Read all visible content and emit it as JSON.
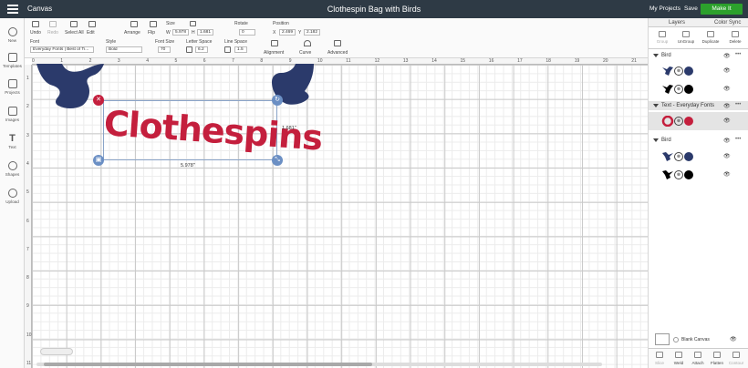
{
  "topbar": {
    "app_label": "Canvas",
    "title": "Clothespin Bag with Birds",
    "my_projects": "My Projects",
    "save": "Save",
    "make_it": "Make It"
  },
  "toolbar": {
    "undo": "Undo",
    "redo": "Redo",
    "select_all": "Select All",
    "edit": "Edit",
    "arrange": "Arrange",
    "flip": "Flip",
    "size_label": "Size",
    "w_label": "W",
    "w_value": "5.978",
    "h_label": "H",
    "h_value": "1.681",
    "rotate_label": "Rotate",
    "rotate_value": "0",
    "position_label": "Position",
    "x_label": "X",
    "x_value": "2.469",
    "y_label": "Y",
    "y_value": "2.182",
    "font_label": "Font",
    "font_value": "Everyday Fonts | Best of Ti...",
    "style_label": "Style",
    "style_value": "Bold",
    "font_size_label": "Font Size",
    "font_size_value": "70",
    "letter_space_label": "Letter Space",
    "letter_space_value": "6.2",
    "line_space_label": "Line Space",
    "line_space_value": "1.5",
    "alignment": "Alignment",
    "curve": "Curve",
    "advanced": "Advanced"
  },
  "leftbar": {
    "items": [
      "New",
      "Templates",
      "Projects",
      "Images",
      "Text",
      "Shapes",
      "Upload"
    ]
  },
  "ruler": {
    "top": [
      "0",
      "1",
      "2",
      "3",
      "4",
      "5",
      "6",
      "7",
      "8",
      "9",
      "10",
      "11",
      "12",
      "13",
      "14",
      "15",
      "16",
      "17",
      "18",
      "19",
      "20",
      "21"
    ],
    "left": [
      "1",
      "2",
      "3",
      "4",
      "5",
      "6",
      "7",
      "8",
      "9",
      "10",
      "11"
    ]
  },
  "canvas": {
    "text": "Clothespins",
    "width_label": "5.978\"",
    "height_label": "1.681\"",
    "zoom": "100%"
  },
  "panel": {
    "tabs": [
      "Layers",
      "Color Sync"
    ],
    "tools": [
      "Group",
      "UnGroup",
      "Duplicate",
      "Delete"
    ],
    "groups": [
      {
        "name": "Bird",
        "layers": [
          {
            "color": "#2b3a6b"
          },
          {
            "color": "#000000"
          }
        ]
      },
      {
        "name": "Text - Everyday Fonts",
        "layers": [
          {
            "color": "#c41f3d"
          }
        ]
      },
      {
        "name": "Bird",
        "layers": [
          {
            "color": "#2b3a6b"
          },
          {
            "color": "#000000"
          }
        ]
      }
    ],
    "blank_canvas": "Blank Canvas",
    "bottom_tools": [
      "Slice",
      "Weld",
      "Attach",
      "Flatten",
      "Contour"
    ]
  },
  "colors": {
    "navy": "#2b3a6b",
    "red": "#c41f3d",
    "green": "#2ca02c",
    "topbar": "#2e3a45"
  }
}
